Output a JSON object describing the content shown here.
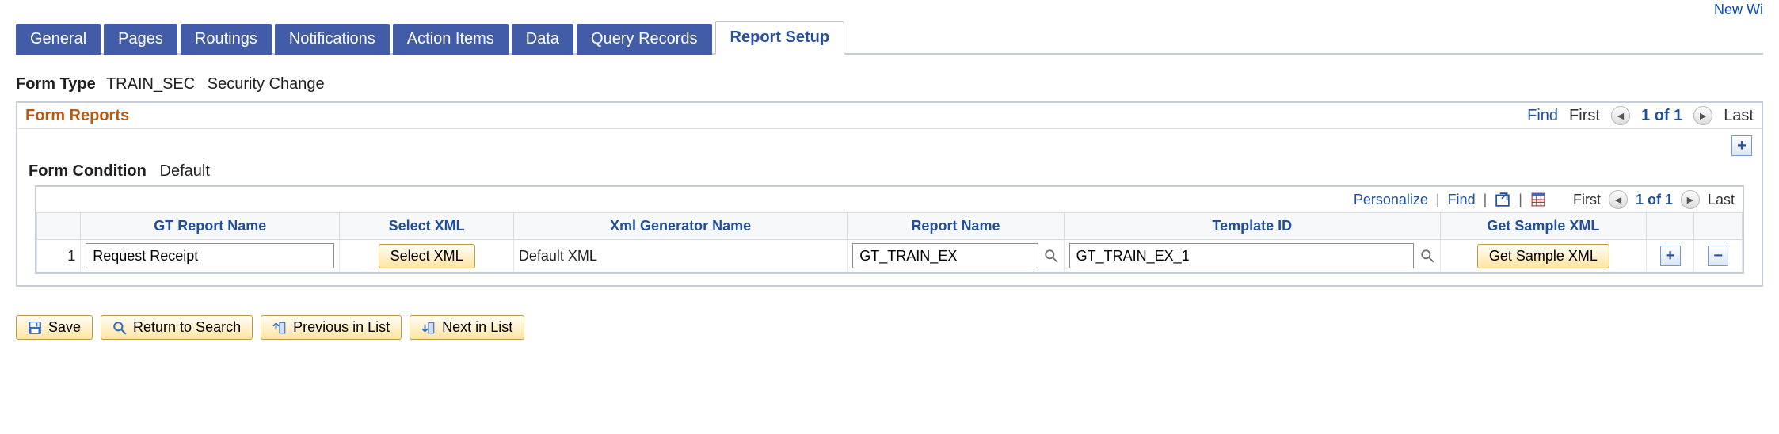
{
  "top_link": "New Wi",
  "tabs": [
    {
      "label": "General",
      "active": false
    },
    {
      "label": "Pages",
      "active": false
    },
    {
      "label": "Routings",
      "active": false
    },
    {
      "label": "Notifications",
      "active": false
    },
    {
      "label": "Action Items",
      "active": false
    },
    {
      "label": "Data",
      "active": false
    },
    {
      "label": "Query Records",
      "active": false
    },
    {
      "label": "Report Setup",
      "active": true
    }
  ],
  "form_type": {
    "label": "Form Type",
    "code": "TRAIN_SEC",
    "desc": "Security Change"
  },
  "section": {
    "title": "Form Reports",
    "find": "Find",
    "first": "First",
    "counter": "1 of 1",
    "last": "Last"
  },
  "form_condition": {
    "label": "Form Condition",
    "value": "Default"
  },
  "grid_nav": {
    "personalize": "Personalize",
    "find": "Find",
    "first": "First",
    "counter": "1 of 1",
    "last": "Last"
  },
  "columns": {
    "gt_report_name": "GT Report Name",
    "select_xml": "Select XML",
    "xml_gen_name": "Xml Generator Name",
    "report_name": "Report Name",
    "template_id": "Template ID",
    "get_sample": "Get Sample XML"
  },
  "rows": [
    {
      "num": "1",
      "gt_report_name": "Request Receipt",
      "select_xml_btn": "Select XML",
      "xml_gen_name": "Default XML",
      "report_name": "GT_TRAIN_EX",
      "template_id": "GT_TRAIN_EX_1",
      "get_sample_btn": "Get Sample XML"
    }
  ],
  "toolbar": {
    "save": "Save",
    "return": "Return to Search",
    "prev": "Previous in List",
    "next": "Next in List"
  }
}
